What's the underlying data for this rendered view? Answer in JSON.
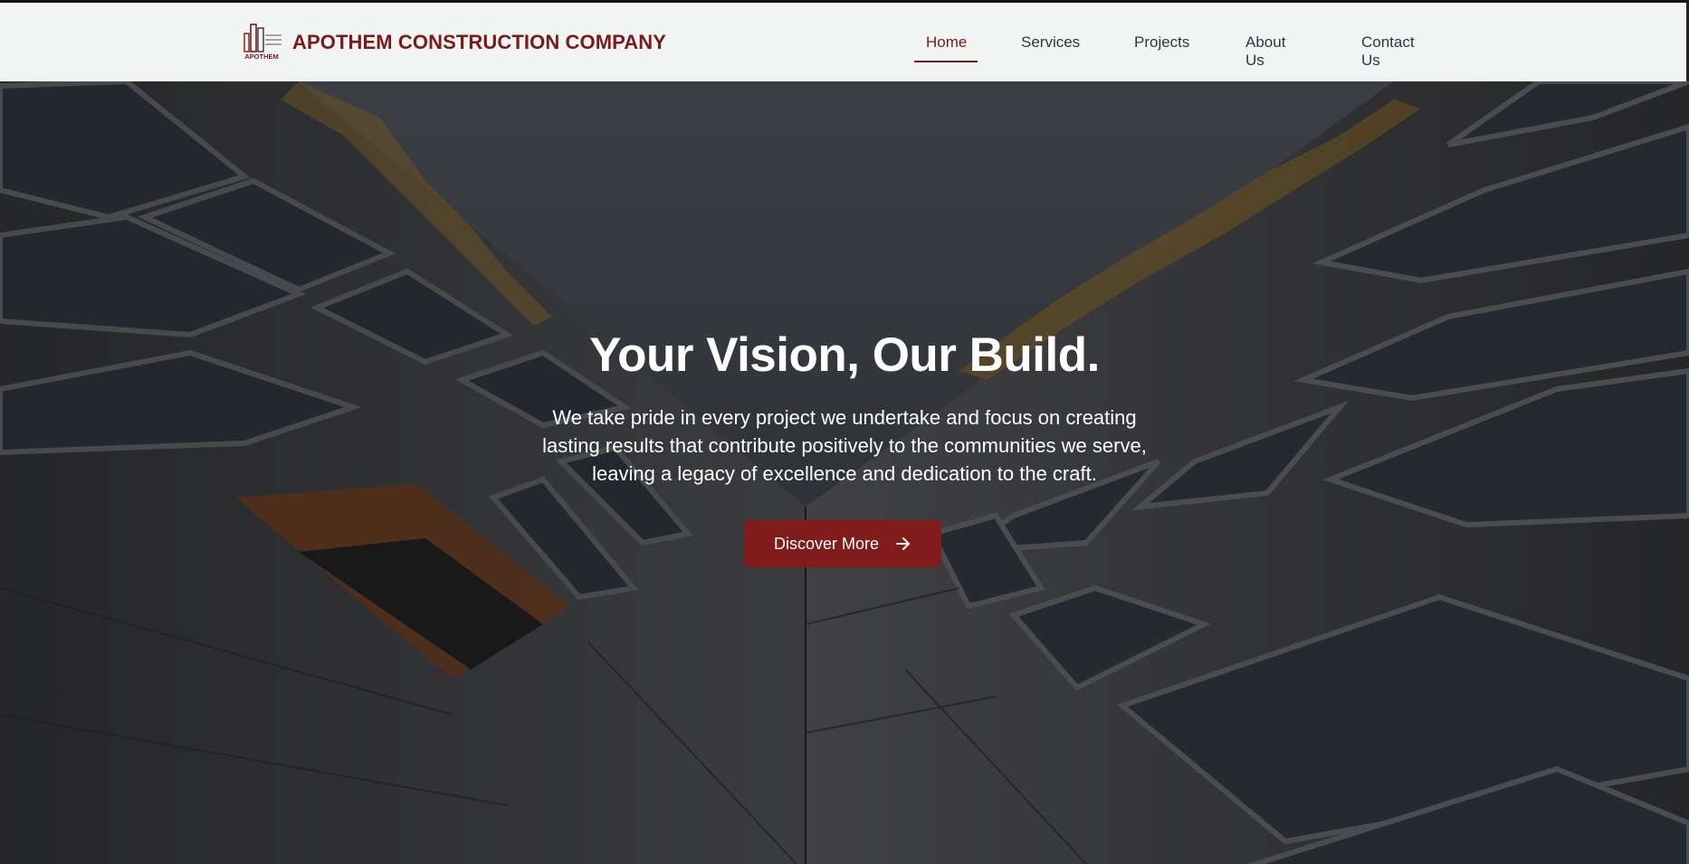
{
  "brand": {
    "name": "APOTHEM CONSTRUCTION COMPANY",
    "logo_icon": "building-logo-icon",
    "logo_text": "APOTHEM",
    "color": "#7b1a1a"
  },
  "nav": {
    "items": [
      {
        "label": "Home",
        "active": true
      },
      {
        "label": "Services",
        "active": false
      },
      {
        "label": "Projects",
        "active": false
      },
      {
        "label": "About Us",
        "active": false
      },
      {
        "label": "Contact Us",
        "active": false
      }
    ]
  },
  "hero": {
    "title": "Your Vision, Our Build.",
    "line1": "We take pride in every project we undertake and focus on creating",
    "line2": "lasting results that contribute positively to the communities we serve,",
    "line3": "leaving a legacy of excellence and dedication to the craft.",
    "cta_label": "Discover More",
    "cta_icon": "arrow-right-icon",
    "background": "building-facade-photo"
  },
  "colors": {
    "accent": "#821b1c",
    "header_bg": "#f3f4f4",
    "nav_text": "#2f3640"
  }
}
